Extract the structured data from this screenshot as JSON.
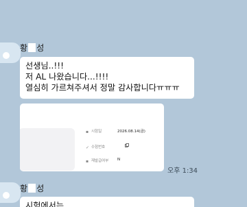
{
  "messages": [
    {
      "sender": {
        "name_part1": "황",
        "name_part2": "성"
      },
      "lines": [
        "선생님..!!!",
        "저 AL 나왔습니다...!!!!",
        "열심히 가르쳐주셔서 정말 감사합니다ㅠㅠㅠ"
      ]
    },
    {
      "card": {
        "rows": [
          {
            "icon": "calendar-icon",
            "label": "시험일",
            "value": "2026.08.14(금)"
          },
          {
            "icon": "check-icon",
            "label": "수험번호",
            "value": ""
          },
          {
            "icon": "document-icon",
            "label": "재발급여부",
            "value": "N"
          }
        ]
      },
      "time": "오후 1:34"
    },
    {
      "sender": {
        "name_part1": "황",
        "name_part2": "성"
      },
      "lines": [
        "시험에서는"
      ]
    }
  ],
  "colors": {
    "background": "#b2c7d9",
    "bubble": "#ffffff",
    "avatar": "#d8e6f1"
  }
}
